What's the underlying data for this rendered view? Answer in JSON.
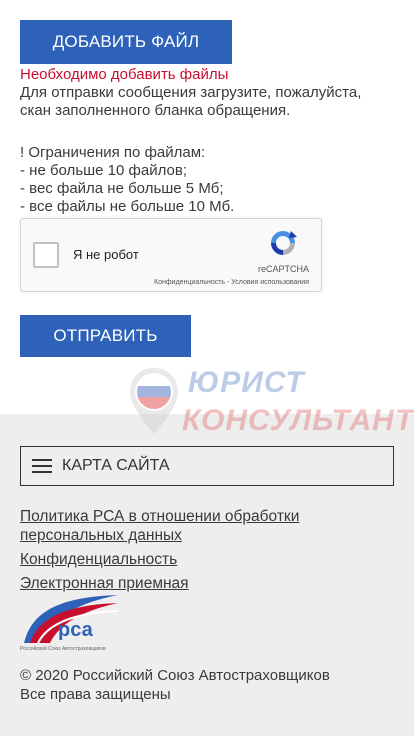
{
  "form": {
    "add_button": "ДОБАВИТЬ ФАЙЛ",
    "error": "Необходимо добавить файлы",
    "help_lines": [
      "Для отправки сообщения загрузите, пожалуйста,",
      "скан заполненного бланка обращения."
    ],
    "limits_lines": [
      "! Ограничения по файлам:",
      "- не больше 10 файлов;",
      "- вес файла не больше 5 Мб;",
      "- все файлы не больше 10 Мб."
    ],
    "send_button": "ОТПРАВИТЬ"
  },
  "captcha": {
    "label": "Я не робот",
    "brand": "reCAPTCHA",
    "links": "Конфиденциальность - Условия использования"
  },
  "watermark": {
    "line1": "ЮРИСТ",
    "line2": "КОНСУЛЬТАНТ"
  },
  "footer": {
    "sitemap_label": "КАРТА САЙТА",
    "links": [
      "Политика РСА в отношении обработки",
      "персональных данных",
      "Конфиденциальность",
      "Электронная приемная"
    ],
    "logo_text": "рса",
    "logo_subtitle": "Российский Союз Автостраховщиков",
    "copyright": "© 2020 Российский Союз Автостраховщиков",
    "rights": "Все права защищены"
  },
  "colors": {
    "primary": "#2e62b9",
    "error": "#c8102e",
    "footer_bg": "#eeeeee"
  },
  "icons": {
    "menu": "hamburger-icon",
    "captcha": "recaptcha-logo-icon",
    "checkbox": "checkbox-icon"
  }
}
